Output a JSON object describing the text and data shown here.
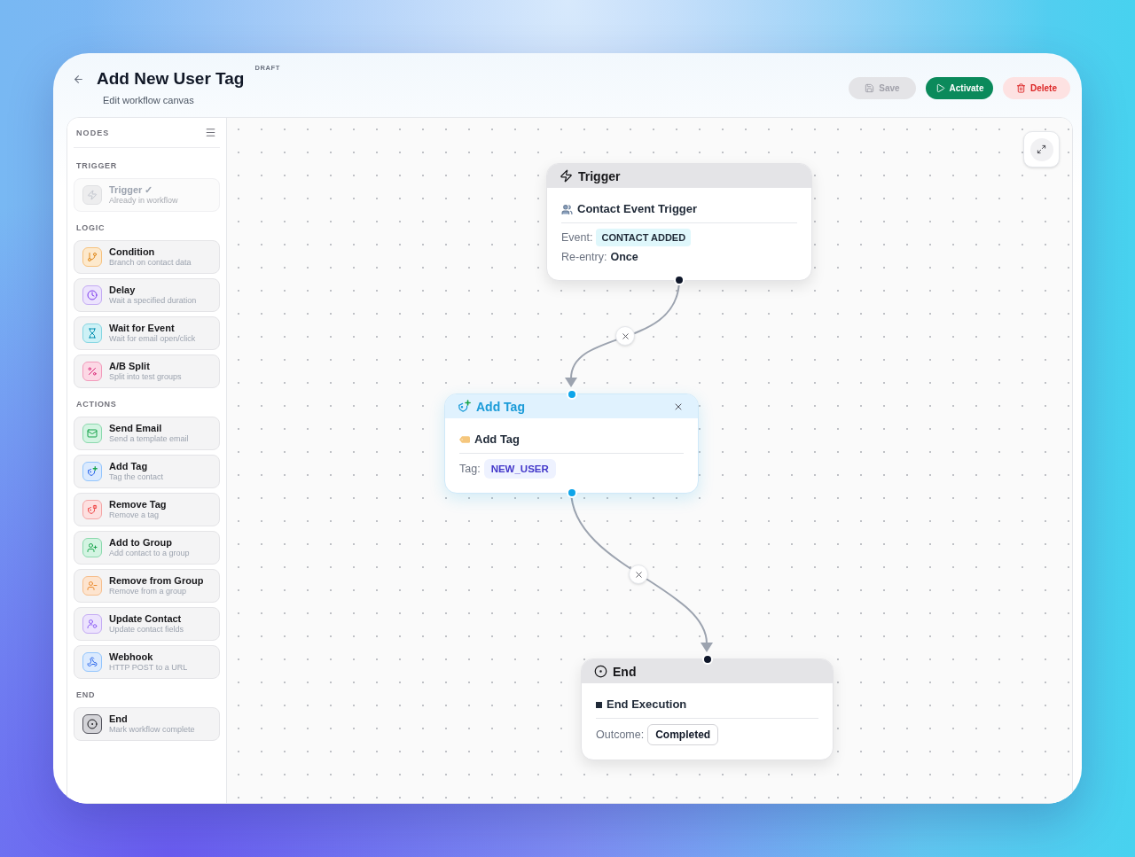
{
  "header": {
    "title": "Add New User Tag",
    "status": "DRAFT",
    "subtitle": "Edit workflow canvas",
    "buttons": [
      {
        "kind": "save",
        "label": "Save",
        "disabled": true
      },
      {
        "kind": "activate",
        "label": "Activate",
        "disabled": false
      },
      {
        "kind": "delete",
        "label": "Delete",
        "disabled": false
      }
    ]
  },
  "sidebar": {
    "title": "NODES",
    "sections": [
      {
        "title": "TRIGGER",
        "items": [
          {
            "kind": "trigger",
            "name": "Trigger ✓",
            "description": "Already in workflow",
            "disabled": true
          }
        ]
      },
      {
        "title": "LOGIC",
        "items": [
          {
            "kind": "condition",
            "name": "Condition",
            "description": "Branch on contact data",
            "disabled": false
          },
          {
            "kind": "delay",
            "name": "Delay",
            "description": "Wait a specified duration",
            "disabled": false
          },
          {
            "kind": "wait_event",
            "name": "Wait for Event",
            "description": "Wait for email open/click",
            "disabled": false
          },
          {
            "kind": "ab_split",
            "name": "A/B Split",
            "description": "Split into test groups",
            "disabled": false
          }
        ]
      },
      {
        "title": "ACTIONS",
        "items": [
          {
            "kind": "send_email",
            "name": "Send Email",
            "description": "Send a template email",
            "disabled": false
          },
          {
            "kind": "add_tag",
            "name": "Add Tag",
            "description": "Tag the contact",
            "disabled": false
          },
          {
            "kind": "remove_tag",
            "name": "Remove Tag",
            "description": "Remove a tag",
            "disabled": false
          },
          {
            "kind": "add_group",
            "name": "Add to Group",
            "description": "Add contact to a group",
            "disabled": false
          },
          {
            "kind": "remove_group",
            "name": "Remove from Group",
            "description": "Remove from a group",
            "disabled": false
          },
          {
            "kind": "update_contact",
            "name": "Update Contact",
            "description": "Update contact fields",
            "disabled": false
          },
          {
            "kind": "webhook",
            "name": "Webhook",
            "description": "HTTP POST to a URL",
            "disabled": false
          }
        ]
      },
      {
        "title": "END",
        "items": [
          {
            "kind": "end",
            "name": "End",
            "description": "Mark workflow complete",
            "disabled": false
          }
        ]
      }
    ]
  },
  "canvas": {
    "nodes": [
      {
        "kind": "trigger",
        "selected": false,
        "title": "Trigger",
        "subtitle": "Contact Event Trigger",
        "fields": [
          {
            "kind": "event",
            "label": "Event:",
            "value": "CONTACT ADDED"
          },
          {
            "kind": "plain",
            "label": "Re-entry:",
            "value": "Once"
          }
        ]
      },
      {
        "kind": "add_tag",
        "selected": true,
        "title": "Add Tag",
        "subtitle": "Add Tag",
        "fields": [
          {
            "kind": "tag",
            "label": "Tag:",
            "value": "NEW_USER"
          }
        ]
      },
      {
        "kind": "end",
        "selected": false,
        "title": "End",
        "subtitle": "End Execution",
        "fields": [
          {
            "kind": "outcome",
            "label": "Outcome:",
            "value": "Completed"
          }
        ]
      }
    ]
  }
}
